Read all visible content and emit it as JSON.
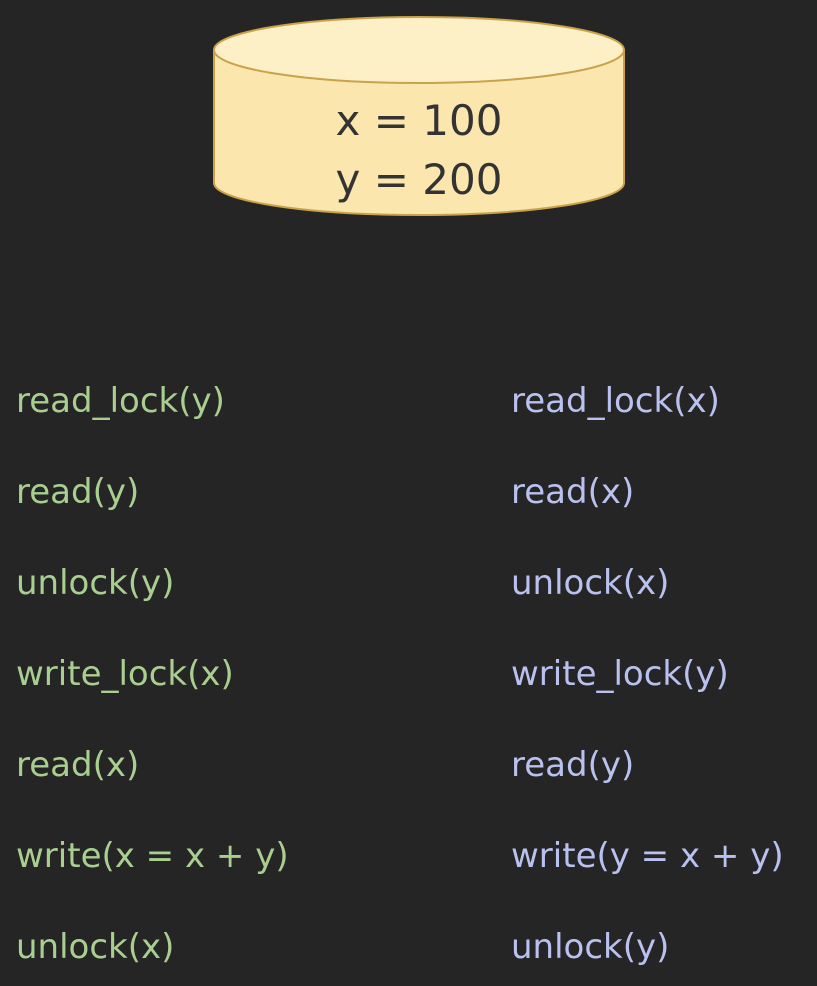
{
  "database": {
    "line_x": "x = 100",
    "line_y": "y = 200"
  },
  "transaction_1": {
    "color": "#a9cf90",
    "operations": [
      "read_lock(y)",
      "read(y)",
      "unlock(y)",
      "write_lock(x)",
      "read(x)",
      "write(x = x + y)",
      "unlock(x)"
    ]
  },
  "transaction_2": {
    "color": "#b9c1ef",
    "operations": [
      "read_lock(x)",
      "read(x)",
      "unlock(x)",
      "write_lock(y)",
      "read(y)",
      "write(y = x + y)",
      "unlock(y)"
    ]
  },
  "colors": {
    "background": "#262526",
    "database_fill": "#fdecb5",
    "database_stroke": "#c9a24a"
  }
}
